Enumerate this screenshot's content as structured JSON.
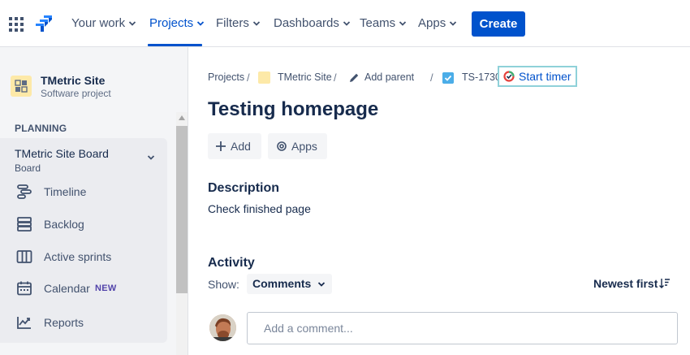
{
  "nav": {
    "items": [
      {
        "label": "Your work"
      },
      {
        "label": "Projects"
      },
      {
        "label": "Filters"
      },
      {
        "label": "Dashboards"
      },
      {
        "label": "Teams"
      },
      {
        "label": "Apps"
      }
    ],
    "active": "Projects",
    "create_label": "Create",
    "accent": "#0052CC"
  },
  "sidebar": {
    "project_name": "TMetric Site",
    "project_type": "Software project",
    "section_label": "PLANNING",
    "board": {
      "title": "TMetric Site Board",
      "subtitle": "Board"
    },
    "items": [
      {
        "label": "Timeline",
        "icon": "timeline-icon"
      },
      {
        "label": "Backlog",
        "icon": "backlog-icon"
      },
      {
        "label": "Active sprints",
        "icon": "sprints-icon"
      },
      {
        "label": "Calendar",
        "icon": "calendar-icon",
        "badge": "NEW"
      },
      {
        "label": "Reports",
        "icon": "reports-icon"
      }
    ]
  },
  "breadcrumb": {
    "projects": "Projects",
    "project": "TMetric Site",
    "add_parent": "Add parent",
    "issue_key": "TS-1730"
  },
  "timer": {
    "label": "Start timer"
  },
  "issue": {
    "title": "Testing homepage",
    "add_label": "Add",
    "apps_label": "Apps",
    "description_heading": "Description",
    "description": "Check finished page"
  },
  "activity": {
    "heading": "Activity",
    "show_label": "Show:",
    "filter_value": "Comments",
    "sort_label": "Newest first",
    "comment_placeholder": "Add a comment..."
  }
}
